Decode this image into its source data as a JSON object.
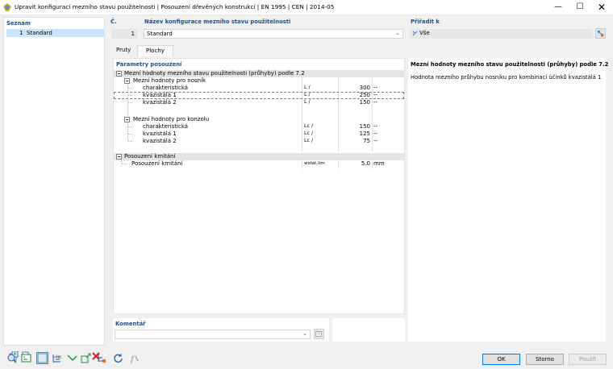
{
  "window": {
    "title": "Upravit konfiguraci mezního stavu použitelnosti | Posouzení dřevěných konstrukcí | EN 1995 | CEN | 2014-05",
    "minimize": "—",
    "maximize": "☐",
    "close": "✕"
  },
  "list_panel": {
    "label": "Seznam",
    "items": [
      {
        "number": "1",
        "name": "Standard"
      }
    ]
  },
  "number": {
    "label": "Č.",
    "value": "1"
  },
  "config_name": {
    "label": "Název konfigurace mezního stavu použitelnosti",
    "value": "Standard"
  },
  "assign": {
    "label": "Přiřadit k",
    "value": "Vše"
  },
  "tabs": [
    {
      "label": "Pruty",
      "active": false
    },
    {
      "label": "Plochy",
      "active": true
    }
  ],
  "params": {
    "label": "Parametry posouzení",
    "rows": [
      {
        "level": 0,
        "label": "Mezní hodnoty mezního stavu použitelnosti (průhyby) podle 7.2",
        "symbol": "",
        "value": "",
        "unit": ""
      },
      {
        "level": 1,
        "label": "Mezní hodnoty pro nosník",
        "symbol": "",
        "value": "",
        "unit": ""
      },
      {
        "level": 2,
        "label": "charakteristická",
        "symbol": "L /",
        "value": "300",
        "unit": "--"
      },
      {
        "level": 2,
        "label": "kvazistálá 1",
        "symbol": "L /",
        "value": "250",
        "unit": "--"
      },
      {
        "level": 2,
        "label": "kvazistálá 2",
        "symbol": "L /",
        "value": "150",
        "unit": "--"
      },
      {
        "level": 1,
        "label": "Mezní hodnoty pro konzolu",
        "symbol": "",
        "value": "",
        "unit": ""
      },
      {
        "level": 2,
        "label": "charakteristická",
        "symbol": "Lc /",
        "value": "150",
        "unit": "--"
      },
      {
        "level": 2,
        "label": "kvazistálá 1",
        "symbol": "Lc /",
        "value": "125",
        "unit": "--"
      },
      {
        "level": 2,
        "label": "kvazistálá 2",
        "symbol": "Lc /",
        "value": "75",
        "unit": "--"
      },
      {
        "level": 0,
        "label": "Posouzení kmitání",
        "symbol": "",
        "value": "",
        "unit": ""
      },
      {
        "level": 2,
        "label": "Posouzení kmitání",
        "symbol": "wstat,lim",
        "value": "5.0",
        "unit": "mm"
      }
    ]
  },
  "comment": {
    "label": "Komentář",
    "value": ""
  },
  "description": {
    "title": "Mezní hodnoty mezního stavu použitelnosti (průhyby) podle 7.2",
    "text": "Hodnota mezního průhybu nosníku pro kombinaci účinků kvazistálá 1"
  },
  "buttons": {
    "ok": "OK",
    "cancel": "Storno",
    "apply": "Použít"
  },
  "colors": {
    "accent": "#1f4f8a",
    "selection": "#cce4f7",
    "ok_border": "#0078d7",
    "delete_red": "#d02020"
  }
}
